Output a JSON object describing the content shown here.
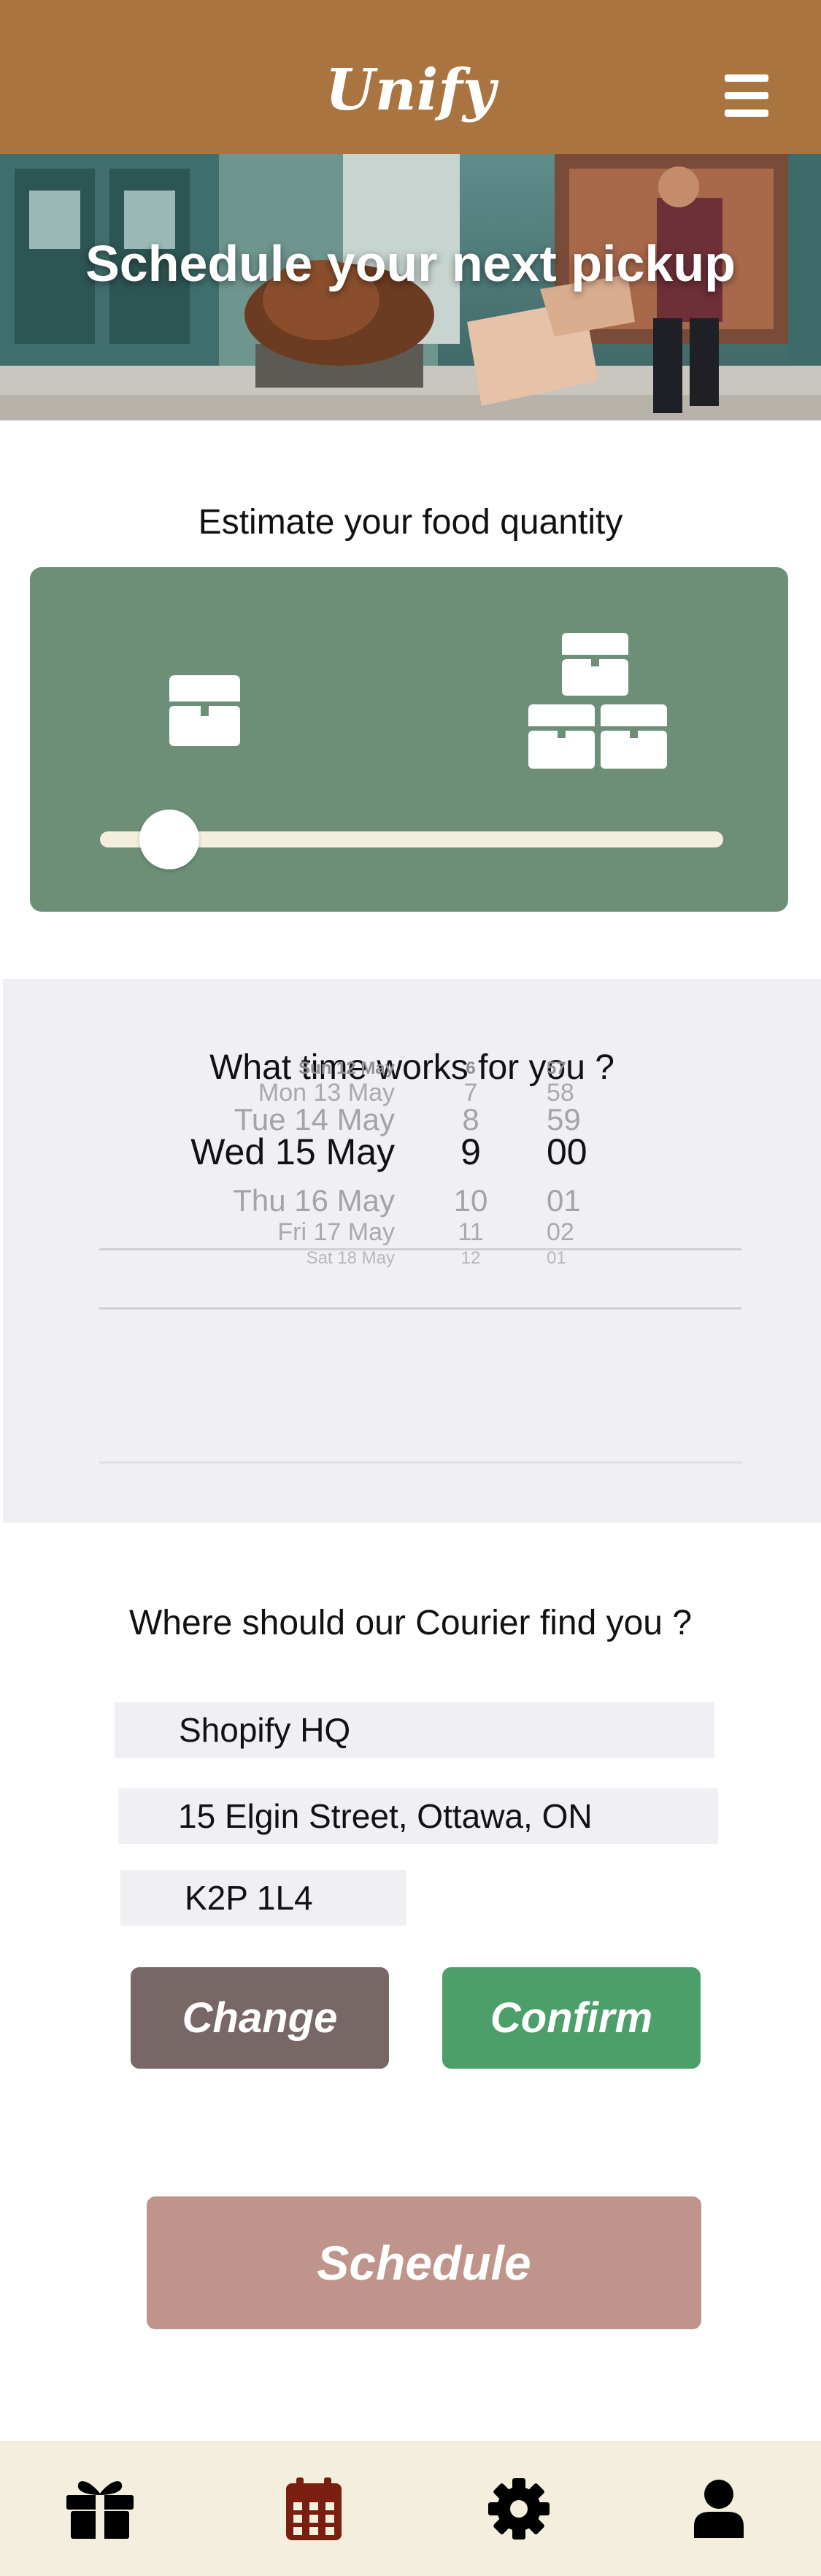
{
  "app": {
    "title": "Unify"
  },
  "header": {
    "menu_icon": "hamburger-menu-icon"
  },
  "hero": {
    "title": "Schedule your next pickup"
  },
  "quantity": {
    "title": "Estimate your food quantity",
    "small_icon": "single-box-icon",
    "large_icon": "multiple-boxes-icon",
    "slider_value_fraction": 0.07
  },
  "time": {
    "title": "What time works for you ?",
    "dates": [
      "Sun 12 May",
      "Mon 13 May",
      "Tue 14 May",
      "Wed 15 May",
      "Thu 16 May",
      "Fri 17 May",
      "Sat 18 May"
    ],
    "hours": [
      "6",
      "7",
      "8",
      "9",
      "10",
      "11",
      "12"
    ],
    "minutes": [
      "57",
      "58",
      "59",
      "00",
      "01",
      "02",
      "01"
    ],
    "selected_index": 3
  },
  "address": {
    "title": "Where should our Courier find you ?",
    "name": "Shopify HQ",
    "street": "15 Elgin Street, Ottawa, ON",
    "postal": "K2P 1L4",
    "change_label": "Change",
    "confirm_label": "Confirm"
  },
  "schedule": {
    "label": "Schedule"
  },
  "tabbar": {
    "items": [
      {
        "icon": "gift-icon",
        "active": false
      },
      {
        "icon": "calendar-icon",
        "active": true
      },
      {
        "icon": "gear-icon",
        "active": false
      },
      {
        "icon": "user-icon",
        "active": false
      }
    ]
  },
  "colors": {
    "header": "#a9743f",
    "quantity_card": "#6d8f78",
    "change_button": "#776767",
    "confirm_button": "#4c9f68",
    "schedule_button": "#bf958b",
    "tabbar": "#f4efdc",
    "active_tab": "#7a1f0f"
  }
}
